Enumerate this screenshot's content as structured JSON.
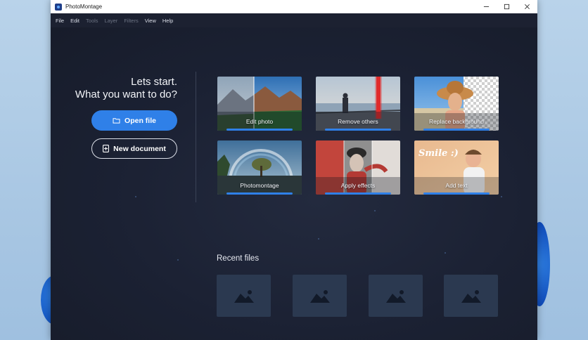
{
  "window": {
    "title": "PhotoMontage"
  },
  "titlebar_controls": [
    "minimize-icon",
    "maximize-icon",
    "close-icon"
  ],
  "menu": [
    {
      "label": "File",
      "enabled": true
    },
    {
      "label": "Edit",
      "enabled": true
    },
    {
      "label": "Tools",
      "enabled": false
    },
    {
      "label": "Layer",
      "enabled": false
    },
    {
      "label": "Filters",
      "enabled": false
    },
    {
      "label": "View",
      "enabled": true
    },
    {
      "label": "Help",
      "enabled": true
    }
  ],
  "intro": {
    "line1": "Lets start.",
    "line2": "What you want to do?"
  },
  "actions": {
    "open_file": "Open file",
    "new_document": "New document"
  },
  "cards": [
    {
      "label": "Edit photo",
      "icon": "mountain-photo-thumbnail"
    },
    {
      "label": "Remove others",
      "icon": "beach-person-thumbnail"
    },
    {
      "label": "Replace background",
      "icon": "woman-hat-thumbnail"
    },
    {
      "label": "Photomontage",
      "icon": "rainbow-tree-thumbnail"
    },
    {
      "label": "Apply effects",
      "icon": "woman-effects-thumbnail"
    },
    {
      "label": "Add text",
      "icon": "smile-text-thumbnail",
      "overlay_text": "Smile :)"
    }
  ],
  "recent": {
    "title": "Recent files",
    "count": 4,
    "icon": "image-placeholder-icon"
  },
  "colors": {
    "accent": "#2f80e8",
    "background": "#1b2030",
    "tile": "#2b3950"
  }
}
